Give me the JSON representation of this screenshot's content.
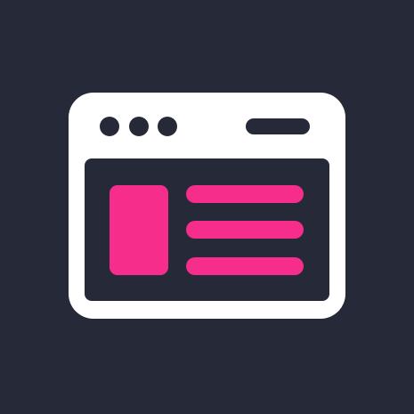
{
  "icon": {
    "name": "browser-window-icon"
  },
  "colors": {
    "background": "#262a38",
    "frame": "#ffffff",
    "accent": "#f72d8c"
  }
}
